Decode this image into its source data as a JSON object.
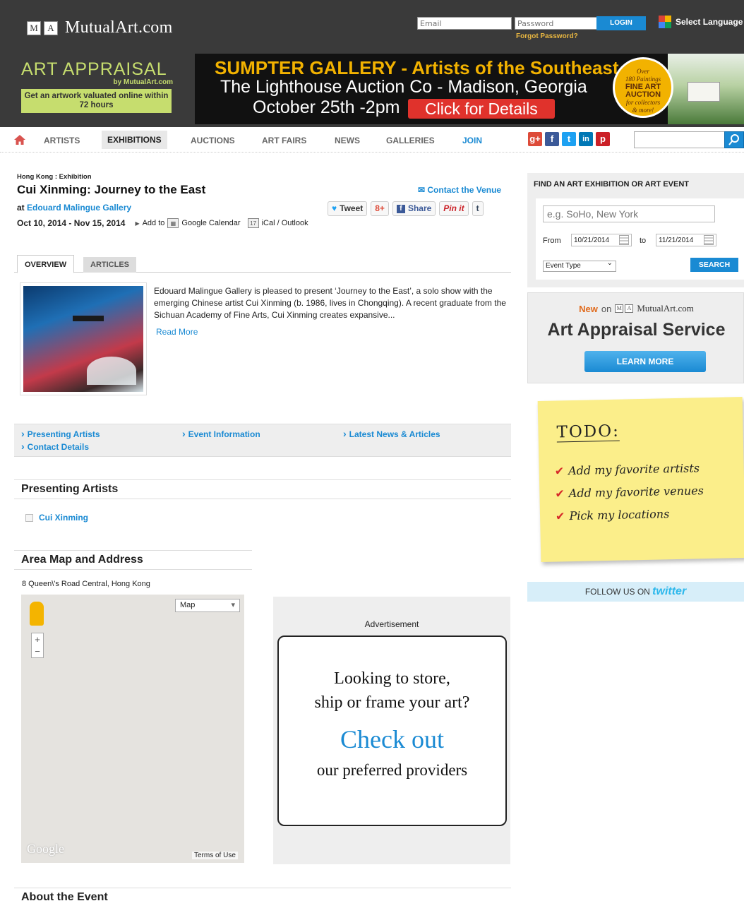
{
  "header": {
    "logo_letters": [
      "M",
      "A"
    ],
    "site_name": "MutualArt.com",
    "email_placeholder": "Email",
    "password_placeholder": "Password",
    "forgot_password": "Forgot Password?",
    "login_label": "LOGIN",
    "select_language": "Select Language"
  },
  "ads": {
    "appraisal_title": "ART APPRAISAL",
    "appraisal_by": "by MutualArt.com",
    "appraisal_button": "Get an artwork valuated online within 72 hours",
    "banner_line1": "SUMPTER GALLERY - Artists of the Southeast",
    "banner_line2": "The Lighthouse Auction Co - Madison, Georgia",
    "banner_line3": "October 25th -2pm",
    "banner_cta": "Click for Details",
    "badge": "Over 180 Paintings FINE ART AUCTION for collectors & more!"
  },
  "nav": {
    "items": [
      "ARTISTS",
      "EXHIBITIONS",
      "AUCTIONS",
      "ART FAIRS",
      "NEWS",
      "GALLERIES",
      "JOIN"
    ],
    "active": "EXHIBITIONS",
    "social": [
      "g+",
      "f",
      "t",
      "in",
      "p"
    ]
  },
  "event": {
    "breadcrumb": "Hong Kong : Exhibition",
    "title": "Cui Xinming: Journey to the East",
    "at_label": "at",
    "venue": "Edouard Malingue Gallery",
    "dates": "Oct 10, 2014 - Nov 15, 2014",
    "add_to": "Add to",
    "google_calendar": "Google Calendar",
    "ical": "iCal / Outlook",
    "contact_venue": "Contact the Venue",
    "share": {
      "tweet": "Tweet",
      "gplus": "8+",
      "fb_share": "Share",
      "pinit": "Pin it",
      "tumblr": "t"
    },
    "tabs": [
      "OVERVIEW",
      "ARTICLES"
    ],
    "description": "Edouard Malingue Gallery is pleased to present ‘Journey to the East’, a solo show with the emerging Chinese artist Cui Xinming (b. 1986, lives in Chongqing). A recent graduate from the Sichuan Academy of Fine Arts, Cui Xinming creates expansive...",
    "read_more": "Read More",
    "quicknav": [
      "Presenting Artists",
      "Event Information",
      "Latest News & Articles",
      "Contact Details"
    ],
    "presenting_artists_heading": "Presenting Artists",
    "artists": [
      "Cui Xinming"
    ],
    "map_heading": "Area Map and Address",
    "address": "8 Queen\\'s Road Central, Hong Kong",
    "map_type": "Map",
    "map_google": "Google",
    "map_terms": "Terms of Use",
    "about_heading": "About the Event"
  },
  "advert": {
    "label": "Advertisement",
    "line1": "Looking to store,",
    "line2": "ship or frame your art?",
    "line3": "Check out",
    "line4": "our preferred providers"
  },
  "sidebar": {
    "find_heading": "FIND AN ART EXHIBITION OR ART EVENT",
    "location_placeholder": "e.g. SoHo, New York",
    "from_label": "From",
    "from_date": "10/21/2014",
    "to_label": "to",
    "to_date": "11/21/2014",
    "event_type": "Event Type",
    "search_label": "SEARCH",
    "aas_new": "New",
    "aas_on": "on",
    "aas_site": "MutualArt.com",
    "aas_title": "Art Appraisal Service",
    "aas_button": "LEARN MORE",
    "todo_title": "TODO:",
    "todo_items": [
      "Add my favorite artists",
      "Add my favorite venues",
      "Pick my locations"
    ],
    "follow_label": "FOLLOW US ON",
    "follow_brand": "twitter"
  },
  "colors": {
    "link_blue": "#1a8ad3",
    "header_dark": "#3a3a3a",
    "appraisal_green": "#c6dd6e",
    "banner_yellow": "#f2b200",
    "cta_red": "#e0322c"
  }
}
